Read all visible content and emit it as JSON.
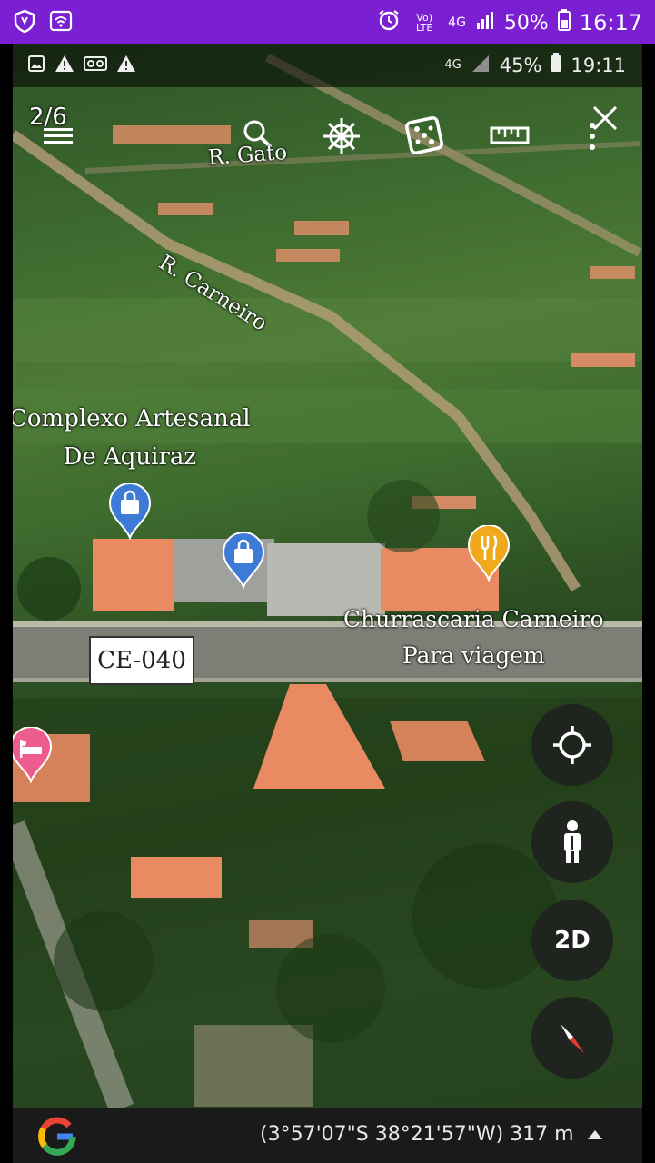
{
  "outer_status": {
    "network": "Vo) LTE",
    "cell": "4G",
    "battery": "50%",
    "time": "16:17"
  },
  "inner_status": {
    "cell": "4G",
    "battery": "45%",
    "time": "19:11"
  },
  "toolbar": {
    "counter": "2/6"
  },
  "map_labels": {
    "street_gato": "R. Gato",
    "street_carneiro": "R. Carneiro",
    "poi_complexo_line1": "Complexo Artesanal",
    "poi_complexo_line2": "De Aquiraz",
    "poi_churrascaria_line1": "Churrascaria Carneiro",
    "poi_churrascaria_line2": "Para viagem",
    "highway": "CE-040"
  },
  "controls": {
    "mode_2d": "2D"
  },
  "bottom_bar": {
    "coordinates": "(3°57'07\"S 38°21'57\"W) 317 m"
  },
  "colors": {
    "status_bar": "#7a1fd1",
    "shop_pin": "#3e7bd6",
    "food_pin": "#f0a81c",
    "hotel_pin": "#ec5d8d",
    "roof": "#e98a63"
  }
}
